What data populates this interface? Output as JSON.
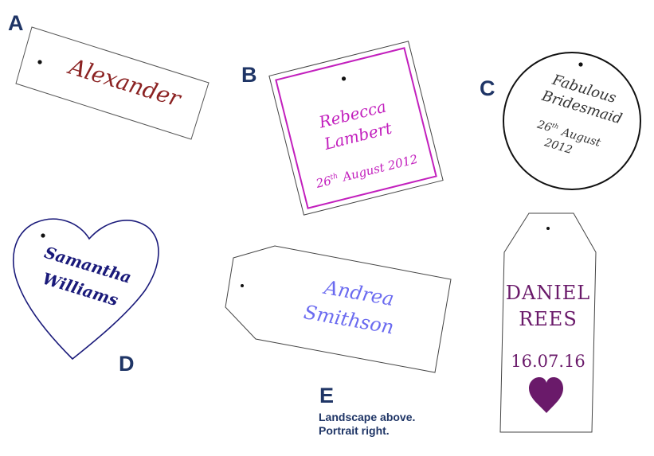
{
  "tags": {
    "a": {
      "letter": "A",
      "name": "Alexander",
      "text_color": "#8b2222"
    },
    "b": {
      "letter": "B",
      "line1": "Rebecca",
      "line2": "Lambert",
      "date_day": "26",
      "date_suffix": "th",
      "date_rest": "August 2012",
      "text_color": "#c21fbd",
      "border_color": "#c21fbd"
    },
    "c": {
      "letter": "C",
      "line1": "Fabulous",
      "line2": "Bridesmaid",
      "date_day": "26",
      "date_suffix": "th",
      "date_month": "August",
      "date_year": "2012",
      "text_color": "#333333"
    },
    "d": {
      "letter": "D",
      "line1": "Samantha",
      "line2": "Williams",
      "text_color": "#1a1a7a",
      "shape": "heart"
    },
    "e": {
      "letter": "E",
      "line1": "Andrea",
      "line2": "Smithson",
      "text_color": "#6b6bf0",
      "shape": "luggage-tag-landscape"
    },
    "f": {
      "line1": "DANIEL",
      "line2": "REES",
      "date": "16.07.16",
      "text_color": "#6a1a6a",
      "icon": "heart-icon",
      "shape": "luggage-tag-portrait"
    }
  },
  "notes": {
    "line1": "Landscape above.",
    "line2": "Portrait right."
  }
}
